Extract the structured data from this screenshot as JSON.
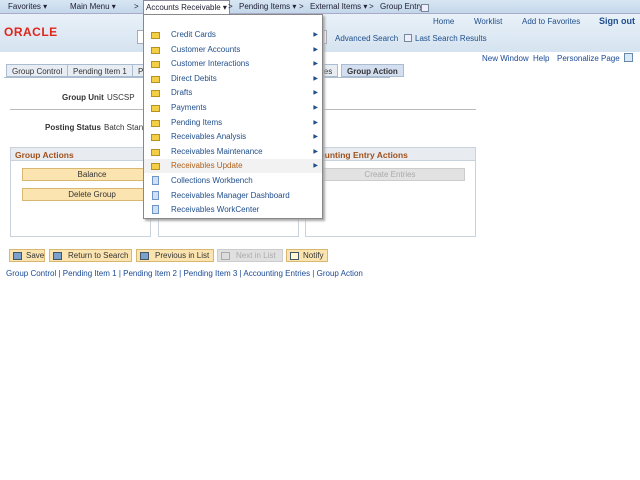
{
  "nav": {
    "favorites": "Favorites ▾",
    "main_menu": "Main Menu ▾",
    "sep": ">",
    "accounts_receivable": "Accounts Receivable ▾",
    "pending_items": "Pending Items ▾",
    "external_items": "External Items ▾",
    "group_entry": "Group Entry"
  },
  "header": {
    "logo": "ORACLE",
    "home": "Home",
    "worklist": "Worklist",
    "add_favorites": "Add to Favorites",
    "sign_out": "Sign out",
    "advanced_search": "Advanced Search",
    "last_search": "Last Search Results"
  },
  "pagebar": {
    "new_window": "New Window",
    "help": "Help",
    "personalize": "Personalize Page"
  },
  "tabs": [
    "Group Control",
    "Pending Item 1",
    "P",
    "ies",
    "Group Action"
  ],
  "form": {
    "group_unit_label": "Group Unit",
    "group_unit_value": "USCSP",
    "posting_status_label": "Posting Status",
    "posting_status_value": "Batch Stand"
  },
  "boxes": {
    "group_actions": "Group Actions",
    "balance": "Balance",
    "delete_group": "Delete Group",
    "accounting_title": "ccounting Entry Actions",
    "create_entries": "Create Entries"
  },
  "toolbar": {
    "save": "Save",
    "return": "Return to Search",
    "previous": "Previous in List",
    "next": "Next in List",
    "notify": "Notify"
  },
  "bottom_links": [
    "Group Control",
    "Pending Item 1",
    "Pending Item 2",
    "Pending Item 3",
    "Accounting Entries",
    "Group Action"
  ],
  "menu": [
    {
      "label": "Credit Cards",
      "type": "folder"
    },
    {
      "label": "Customer Accounts",
      "type": "folder"
    },
    {
      "label": "Customer Interactions",
      "type": "folder"
    },
    {
      "label": "Direct Debits",
      "type": "folder"
    },
    {
      "label": "Drafts",
      "type": "folder"
    },
    {
      "label": "Payments",
      "type": "folder"
    },
    {
      "label": "Pending Items",
      "type": "folder"
    },
    {
      "label": "Receivables Analysis",
      "type": "folder"
    },
    {
      "label": "Receivables Maintenance",
      "type": "folder"
    },
    {
      "label": "Receivables Update",
      "type": "folder",
      "highlighted": true
    },
    {
      "label": "Collections Workbench",
      "type": "page"
    },
    {
      "label": "Receivables Manager Dashboard",
      "type": "page"
    },
    {
      "label": "Receivables WorkCenter",
      "type": "page"
    }
  ]
}
